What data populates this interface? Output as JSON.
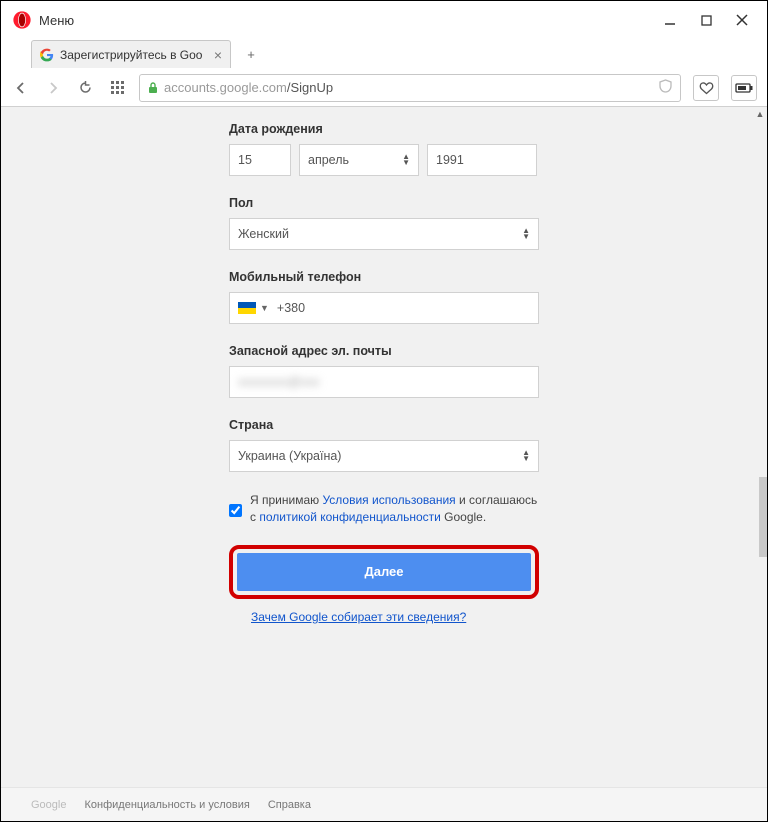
{
  "window": {
    "menu_label": "Меню"
  },
  "tab": {
    "title": "Зарегистрируйтесь в Goo"
  },
  "addressbar": {
    "host": "accounts.google.com",
    "path": "/SignUp"
  },
  "form": {
    "dob": {
      "label": "Дата рождения",
      "day": "15",
      "month": "апрель",
      "year": "1991"
    },
    "gender": {
      "label": "Пол",
      "value": "Женский"
    },
    "phone": {
      "label": "Мобильный телефон",
      "code": "+380"
    },
    "recovery": {
      "label": "Запасной адрес эл. почты",
      "value": "xxxxxxxx@xxx"
    },
    "country": {
      "label": "Страна",
      "value": "Украина (Україна)"
    },
    "tos": {
      "p1": "Я принимаю ",
      "link1": "Условия использования",
      "p2": " и соглашаюсь с ",
      "link2": "политикой конфиденциальности",
      "p3": " Google."
    },
    "next_label": "Далее",
    "why_link": "Зачем Google собирает эти сведения?"
  },
  "footer": {
    "google": "Google",
    "privacy": "Конфиденциальность и условия",
    "help": "Справка"
  }
}
